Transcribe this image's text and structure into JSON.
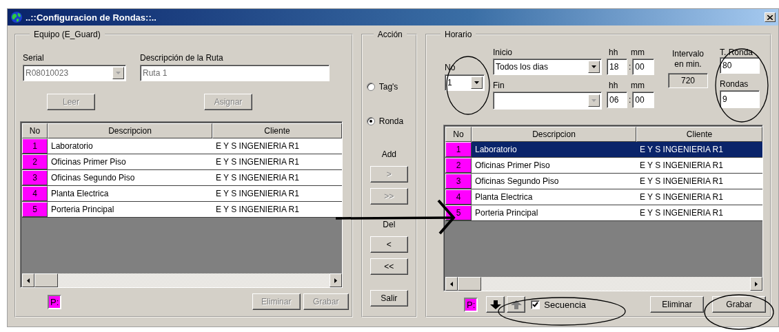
{
  "window": {
    "title": "..::Configuracion de Rondas::.."
  },
  "equipo": {
    "title": "Equipo (E_Guard)",
    "serial": {
      "label": "Serial",
      "value": "R08010023",
      "disabled": true
    },
    "ruta": {
      "label": "Descripción de la Ruta",
      "value": "Ruta 1",
      "disabled": true
    },
    "top_buttons": [
      {
        "label": "Leer",
        "disabled": true
      },
      {
        "label": "Asignar",
        "disabled": true
      }
    ],
    "table": {
      "columns": [
        "No",
        "Descripcion",
        "Cliente"
      ],
      "rows": [
        {
          "no": "1",
          "descripcion": "Laboratorio",
          "cliente": "E Y S INGENIERIA R1",
          "selected": false
        },
        {
          "no": "2",
          "descripcion": "Oficinas Primer Piso",
          "cliente": "E Y S INGENIERIA R1",
          "selected": false
        },
        {
          "no": "3",
          "descripcion": "Oficinas Segundo Piso",
          "cliente": "E Y S INGENIERIA R1",
          "selected": false
        },
        {
          "no": "4",
          "descripcion": "Planta Electrica",
          "cliente": "E Y S INGENIERIA R1",
          "selected": false
        },
        {
          "no": "5",
          "descripcion": "Porteria Principal",
          "cliente": "E Y S INGENIERIA R1",
          "selected": false
        }
      ]
    },
    "marker": "P:",
    "bottom_buttons": [
      {
        "label": "Eliminar",
        "disabled": true
      },
      {
        "label": "Grabar",
        "disabled": true
      }
    ]
  },
  "accion": {
    "title": "Acción",
    "radios": [
      {
        "label": "Tag's",
        "selected": false
      },
      {
        "label": "Ronda",
        "selected": true
      }
    ],
    "add": {
      "label": "Add",
      "buttons": [
        {
          "label": ">",
          "disabled": true
        },
        {
          "label": ">>",
          "disabled": true
        }
      ]
    },
    "del": {
      "label": "Del",
      "buttons": [
        {
          "label": "<",
          "disabled": false
        },
        {
          "label": "<<",
          "disabled": false
        }
      ]
    },
    "exit_button": {
      "label": "Salir",
      "disabled": false
    }
  },
  "horario": {
    "title": "Horario",
    "no": {
      "label": "No",
      "value": "1"
    },
    "inicio": {
      "label": "Inicio",
      "value": "Todos los dias",
      "disabled": false
    },
    "fin": {
      "label": "Fin",
      "disabled": true
    },
    "start_time": {
      "hh_label": "hh",
      "mm_label": "mm",
      "hh": "18",
      "separator": ":",
      "mm": "00"
    },
    "end_time": {
      "hh_label": "hh",
      "mm_label": "mm",
      "hh": "06",
      "separator": ":",
      "mm": "00"
    },
    "intervalo": {
      "label": "Intervalo en min.",
      "value": "720"
    },
    "t_ronda": {
      "label": "T. Ronda",
      "value": "80"
    },
    "rondas": {
      "label": "Rondas",
      "value": "9"
    },
    "table": {
      "columns": [
        "No",
        "Descripcion",
        "Cliente"
      ],
      "rows": [
        {
          "no": "1",
          "descripcion": "Laboratorio",
          "cliente": "E Y S INGENIERIA R1",
          "selected": true
        },
        {
          "no": "2",
          "descripcion": "Oficinas Primer Piso",
          "cliente": "E Y S INGENIERIA R1",
          "selected": false
        },
        {
          "no": "3",
          "descripcion": "Oficinas Segundo Piso",
          "cliente": "E Y S INGENIERIA R1",
          "selected": false
        },
        {
          "no": "4",
          "descripcion": "Planta Electrica",
          "cliente": "E Y S INGENIERIA R1",
          "selected": false
        },
        {
          "no": "5",
          "descripcion": "Porteria Principal",
          "cliente": "E Y S INGENIERIA R1",
          "selected": false
        }
      ]
    },
    "marker": "P:",
    "move_buttons": [
      {
        "kind": "down",
        "disabled": false
      },
      {
        "kind": "up",
        "disabled": true
      }
    ],
    "secuencia": {
      "label": "Secuencia",
      "checked": true
    },
    "buttons": [
      {
        "label": "Eliminar",
        "disabled": false
      },
      {
        "label": "Grabar",
        "disabled": false
      }
    ]
  }
}
